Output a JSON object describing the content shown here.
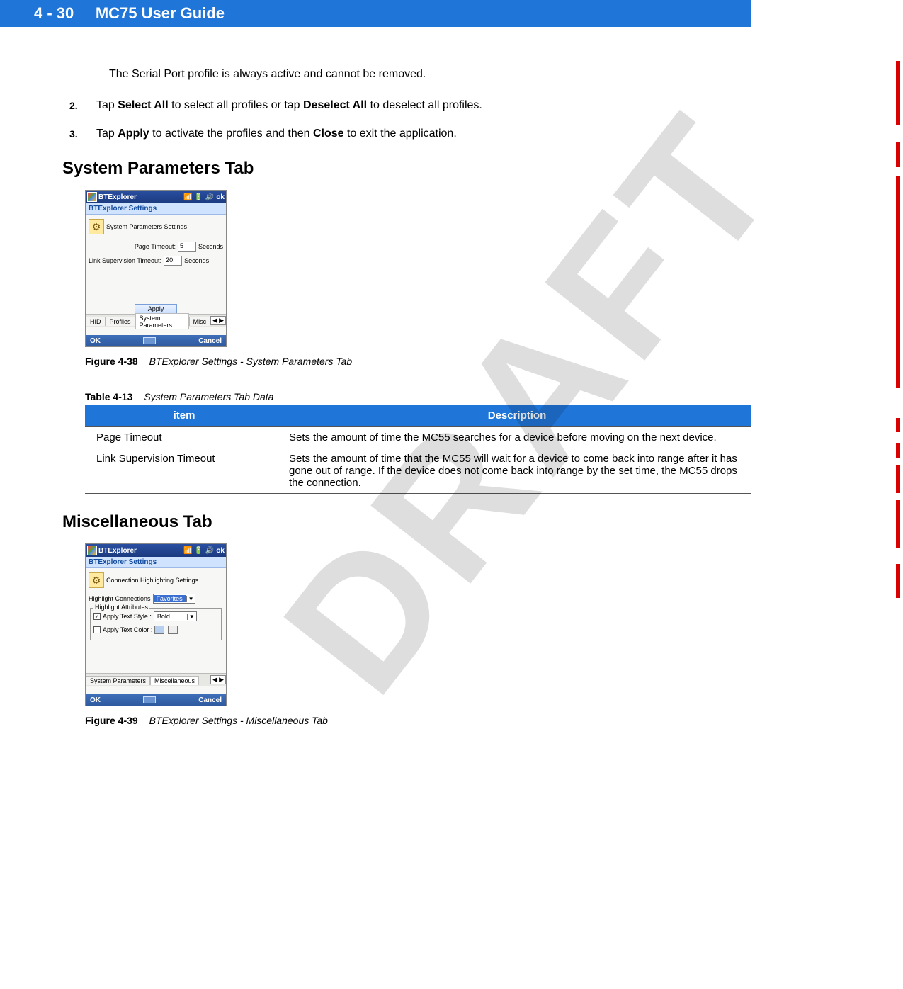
{
  "watermark": "DRAFT",
  "header": {
    "page": "4 - 30",
    "title": "MC75 User Guide"
  },
  "intro": "The Serial Port profile is always active and cannot be removed.",
  "steps": [
    {
      "num": "2.",
      "pre": "Tap ",
      "b1": "Select All",
      "mid": " to select all profiles or tap ",
      "b2": "Deselect All",
      "post": " to deselect all profiles."
    },
    {
      "num": "3.",
      "pre": "Tap ",
      "b1": "Apply",
      "mid": " to activate the profiles and then ",
      "b2": "Close",
      "post": " to exit the application."
    }
  ],
  "section1": "System Parameters Tab",
  "device1": {
    "title": "BTExplorer",
    "ok": "ok",
    "sub": "BTExplorer Settings",
    "settings_title": "System Parameters Settings",
    "page_timeout_label": "Page Timeout:",
    "page_timeout_value": "5",
    "link_label": "Link Supervision Timeout:",
    "link_value": "20",
    "seconds": "Seconds",
    "apply": "Apply",
    "tabs": {
      "hid": "HID",
      "profiles": "Profiles",
      "sys": "System Parameters",
      "misc": "Misc"
    },
    "bottom_ok": "OK",
    "bottom_cancel": "Cancel"
  },
  "fig38": {
    "label": "Figure 4-38",
    "text": "BTExplorer Settings - System Parameters Tab"
  },
  "table13_title": {
    "label": "Table 4-13",
    "text": "System Parameters Tab Data"
  },
  "table13": {
    "head": {
      "item": "item",
      "desc": "Description"
    },
    "rows": [
      {
        "item": "Page Timeout",
        "desc": "Sets the amount of time the MC55 searches for a device before moving on the next device."
      },
      {
        "item": "Link Supervision Timeout",
        "desc": "Sets the amount of time that the MC55 will wait for a device to come back into range after it has gone out of range. If the device does not come back into range by the set time, the MC55 drops the connection."
      }
    ]
  },
  "section2": "Miscellaneous Tab",
  "device2": {
    "title": "BTExplorer",
    "ok": "ok",
    "sub": "BTExplorer Settings",
    "conn_title": "Connection Highlighting Settings",
    "hc_label": "Highlight Connections",
    "hc_value": "Favorites",
    "fs_legend": "Highlight Attributes",
    "apply_style": "Apply Text Style :",
    "style_val": "Bold",
    "apply_color": "Apply Text Color :",
    "tabs": {
      "sys": "System Parameters",
      "misc": "Miscellaneous"
    },
    "bottom_ok": "OK",
    "bottom_cancel": "Cancel"
  },
  "fig39": {
    "label": "Figure 4-39",
    "text": "BTExplorer Settings - Miscellaneous Tab"
  }
}
